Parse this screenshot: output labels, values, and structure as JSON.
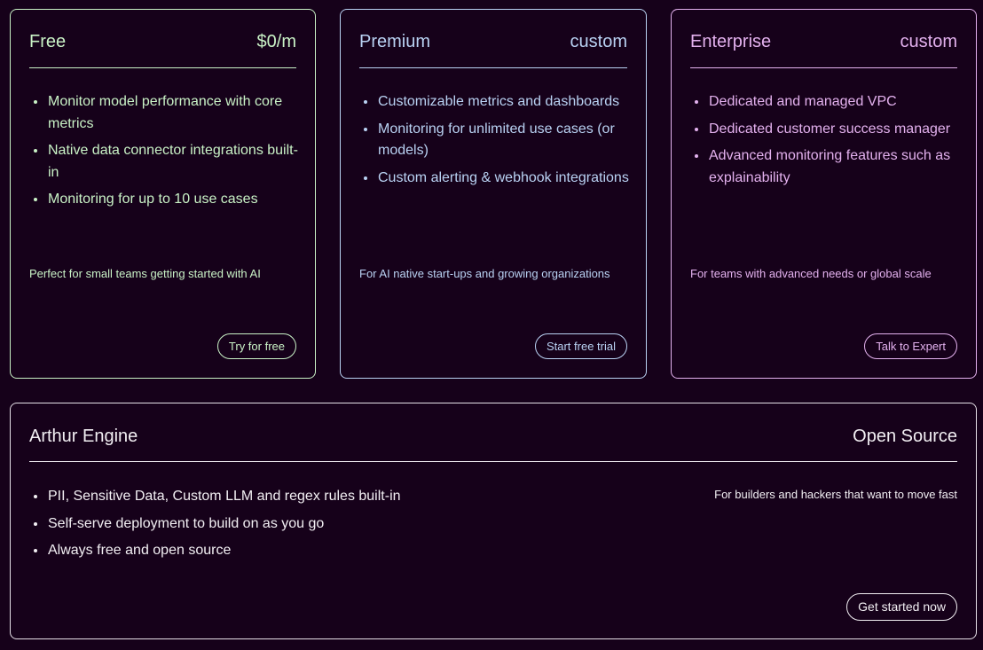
{
  "plans": [
    {
      "name": "Free",
      "price": "$0/m",
      "features": [
        "Monitor model performance with core metrics",
        "Native data connector integrations built-in",
        "Monitoring for up to 10 use cases"
      ],
      "tagline": "Perfect for small teams getting started with AI",
      "cta": "Try for free",
      "accent": "#c9f2c6"
    },
    {
      "name": "Premium",
      "price": "custom",
      "features": [
        "Customizable metrics and dashboards",
        "Monitoring for unlimited use cases (or models)",
        "Custom alerting & webhook integrations"
      ],
      "tagline": "For AI native start-ups and growing organizations",
      "cta": "Start free trial",
      "accent": "#b9d2f3"
    },
    {
      "name": "Enterprise",
      "price": "custom",
      "features": [
        "Dedicated and managed VPC",
        "Dedicated customer success manager",
        "Advanced monitoring features such as explainability"
      ],
      "tagline": "For teams with advanced needs or global scale",
      "cta": "Talk to Expert",
      "accent": "#e3b1ee"
    }
  ],
  "engine": {
    "name": "Arthur Engine",
    "price": "Open Source",
    "features": [
      "PII, Sensitive Data, Custom LLM and regex rules built-in",
      "Self-serve deployment to build on as you go",
      "Always free and open source"
    ],
    "tagline": "For builders and hackers that want to move fast",
    "cta": "Get started now",
    "accent": "#e6e1e8"
  },
  "colors": {
    "background": "#16011a"
  }
}
